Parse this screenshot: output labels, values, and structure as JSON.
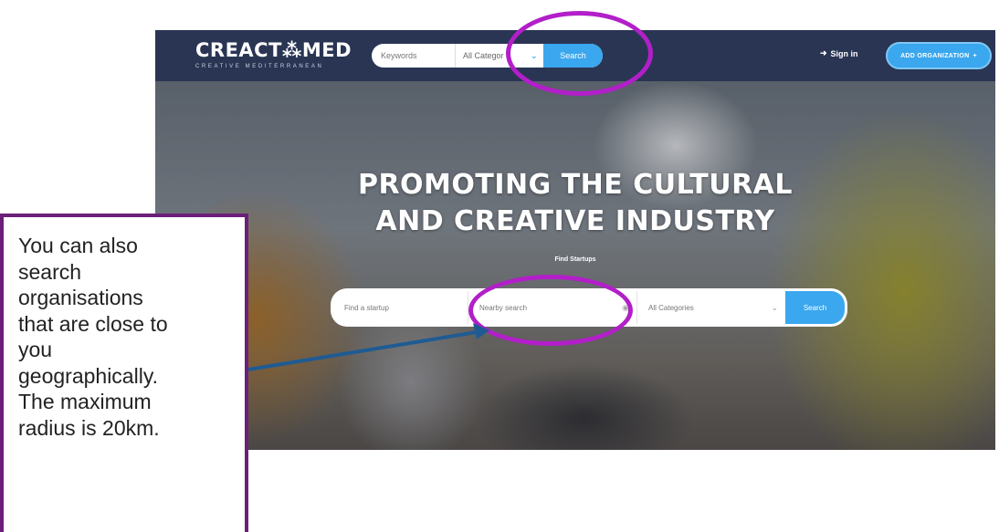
{
  "navbar": {
    "logo_main": "CREACT⁂MED",
    "logo_sub": "CREATIVE MEDITERRANEAN",
    "keyword_placeholder": "Keywords",
    "category_label": "All Categor",
    "search_label": "Search",
    "signin_label": "Sign in",
    "add_org_label": "ADD ORGANIZATION",
    "add_org_plus": "+"
  },
  "hero": {
    "title_line1": "PROMOTING THE CULTURAL",
    "title_line2": "AND CREATIVE INDUSTRY",
    "subtitle": "Find Startups"
  },
  "main_search": {
    "startup_placeholder": "Find a startup",
    "nearby_label": "Nearby search",
    "category_label": "All Categories",
    "search_label": "Search"
  },
  "annotation": {
    "lines": [
      "You can also",
      "search",
      "organisations",
      "that are close to",
      "you",
      "geographically.",
      "The maximum",
      "radius is 20km."
    ]
  },
  "colors": {
    "navbar": "#2a3554",
    "accent": "#3aa7ee",
    "highlight": "#b21fc9",
    "callout_border": "#6b1f7a",
    "arrow": "#1f5b93"
  },
  "icons": {
    "chevron": "chevron-down-icon",
    "signin": "sign-in-icon",
    "location": "location-icon"
  }
}
